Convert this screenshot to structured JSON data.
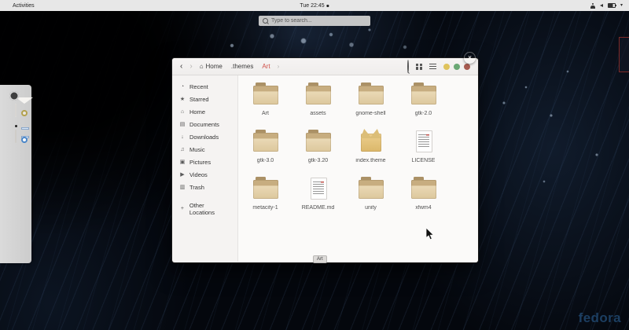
{
  "topbar": {
    "activities_label": "Activities",
    "clock": "Tue 22:45",
    "caret_glyph": "▾",
    "status_icons": [
      "accessibility-icon",
      "volume-icon",
      "battery-icon",
      "caret-down-icon"
    ]
  },
  "desktop_search": {
    "placeholder": "Type to search..."
  },
  "dock": {
    "apps": [
      "firefox",
      "evolution-mail",
      "rhythmbox",
      "files",
      "boxes",
      "show-applications"
    ],
    "running_app": "files"
  },
  "window": {
    "header": {
      "nav": {
        "back": "‹",
        "forward": "›"
      },
      "breadcrumbs": [
        {
          "label": "Home",
          "glyph": "⌂"
        },
        {
          "label": ".themes"
        },
        {
          "label": "Art",
          "state": "active"
        }
      ],
      "trailing_chevron": "›",
      "close_glyph": "×"
    },
    "sidebar": {
      "items": [
        {
          "label": "Recent",
          "glyph": "◔"
        },
        {
          "label": "Starred",
          "glyph": "★"
        },
        {
          "label": "Home",
          "glyph": "⌂"
        },
        {
          "label": "Documents",
          "glyph": "▤"
        },
        {
          "label": "Downloads",
          "glyph": "↓"
        },
        {
          "label": "Music",
          "glyph": "♫"
        },
        {
          "label": "Pictures",
          "glyph": "▣"
        },
        {
          "label": "Videos",
          "glyph": "▶"
        },
        {
          "label": "Trash",
          "glyph": "▥"
        }
      ],
      "other_locations": {
        "label": "Other Locations",
        "glyph": "+"
      }
    },
    "files": {
      "items": [
        {
          "name": "Art",
          "type": "folder"
        },
        {
          "name": "assets",
          "type": "folder"
        },
        {
          "name": "gnome-shell",
          "type": "folder"
        },
        {
          "name": "gtk-2.0",
          "type": "folder"
        },
        {
          "name": "gtk-3.0",
          "type": "folder"
        },
        {
          "name": "gtk-3.20",
          "type": "folder"
        },
        {
          "name": "index.theme",
          "type": "theme"
        },
        {
          "name": "LICENSE",
          "type": "document"
        },
        {
          "name": "metacity-1",
          "type": "folder"
        },
        {
          "name": "README.md",
          "type": "document"
        },
        {
          "name": "unity",
          "type": "folder"
        },
        {
          "name": "xfwm4",
          "type": "folder"
        }
      ]
    },
    "status_tag": "Art"
  },
  "branding": {
    "fedora_logo": "fedora"
  },
  "colors": {
    "breadcrumb_active": "#cf5048",
    "dot_minimize": "#dfc35c",
    "dot_maximize": "#6aa874",
    "dot_close": "#a85b50",
    "close_button": "#e05a54",
    "folder_tan": "#e0cda2",
    "files_app_blue": "#5f8fcd",
    "fedora_logo": "#1e4368",
    "topbar_bg": "#e7e7e7",
    "dock_bg": "#d4d4d4"
  }
}
